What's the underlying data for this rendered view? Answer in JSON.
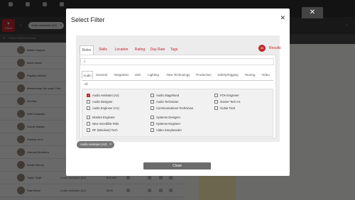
{
  "background": {
    "filters_label": "Filters",
    "selected_chip": "Audio Assistant (A2)",
    "search_placeholder": "Search filtered results",
    "people": [
      {
        "name": "Blaike Hopper"
      },
      {
        "name": "Marin Marsi"
      },
      {
        "name": "Payday Abbers"
      },
      {
        "name": "Wednesday 'the push' Kell..."
      },
      {
        "name": "Art Mac"
      },
      {
        "name": "Kelli Costratia"
      },
      {
        "name": "Carole Basley"
      },
      {
        "name": "Paisiha Jims"
      },
      {
        "name": "Hannah Montelra"
      },
      {
        "name": "Dustin Bunny"
      },
      {
        "name": "Taylor Swift",
        "role": "Audio Assistant (A2)",
        "rate": "$18,000"
      },
      {
        "name": "Seal Morel",
        "role": "Audio Assistant (A2)",
        "rate": "$300"
      }
    ]
  },
  "modal": {
    "title": "Select Filter",
    "close_icon": "close-icon",
    "tabs": [
      "Roles",
      "Skills",
      "Location",
      "Rating",
      "Day Rate",
      "Tags"
    ],
    "active_tab": "Roles",
    "results_count": "35",
    "results_label": "Results",
    "search_value": "",
    "subtabs": [
      "Audio",
      "General",
      "Integration",
      "LED",
      "Lighting",
      "New Technology",
      "Production",
      "Safety/Rigging",
      "Touring",
      "Video",
      "All"
    ],
    "active_subtab": "Audio",
    "options": [
      {
        "label": "Audio Assistant (A2)",
        "checked": true
      },
      {
        "label": "Audio Designer",
        "checked": false
      },
      {
        "label": "Audio Engineer (A1)",
        "checked": false
      },
      {
        "label": "Monitor Engineer",
        "checked": false
      },
      {
        "label": "New Incredible Role",
        "checked": false
      },
      {
        "label": "RF (Wireless) Tech",
        "checked": false
      },
      {
        "label": "Audio Stagehand",
        "checked": false
      },
      {
        "label": "Audio Technician",
        "checked": false
      },
      {
        "label": "Communications Technician",
        "checked": false
      },
      {
        "label": "Systems Designer",
        "checked": false
      },
      {
        "label": "Systems Engineer",
        "checked": false
      },
      {
        "label": "Video Storyboarder",
        "checked": false
      },
      {
        "label": "FOH Engineer",
        "checked": false
      },
      {
        "label": "Gamer Tech A1",
        "checked": false
      },
      {
        "label": "Guitar Tech",
        "checked": false
      }
    ],
    "selected_chip": "Audio Assistant (A2)",
    "close_button": "Close"
  },
  "colors": {
    "accent": "#c0272d",
    "overlay": "rgba(0,0,0,0.58)"
  }
}
